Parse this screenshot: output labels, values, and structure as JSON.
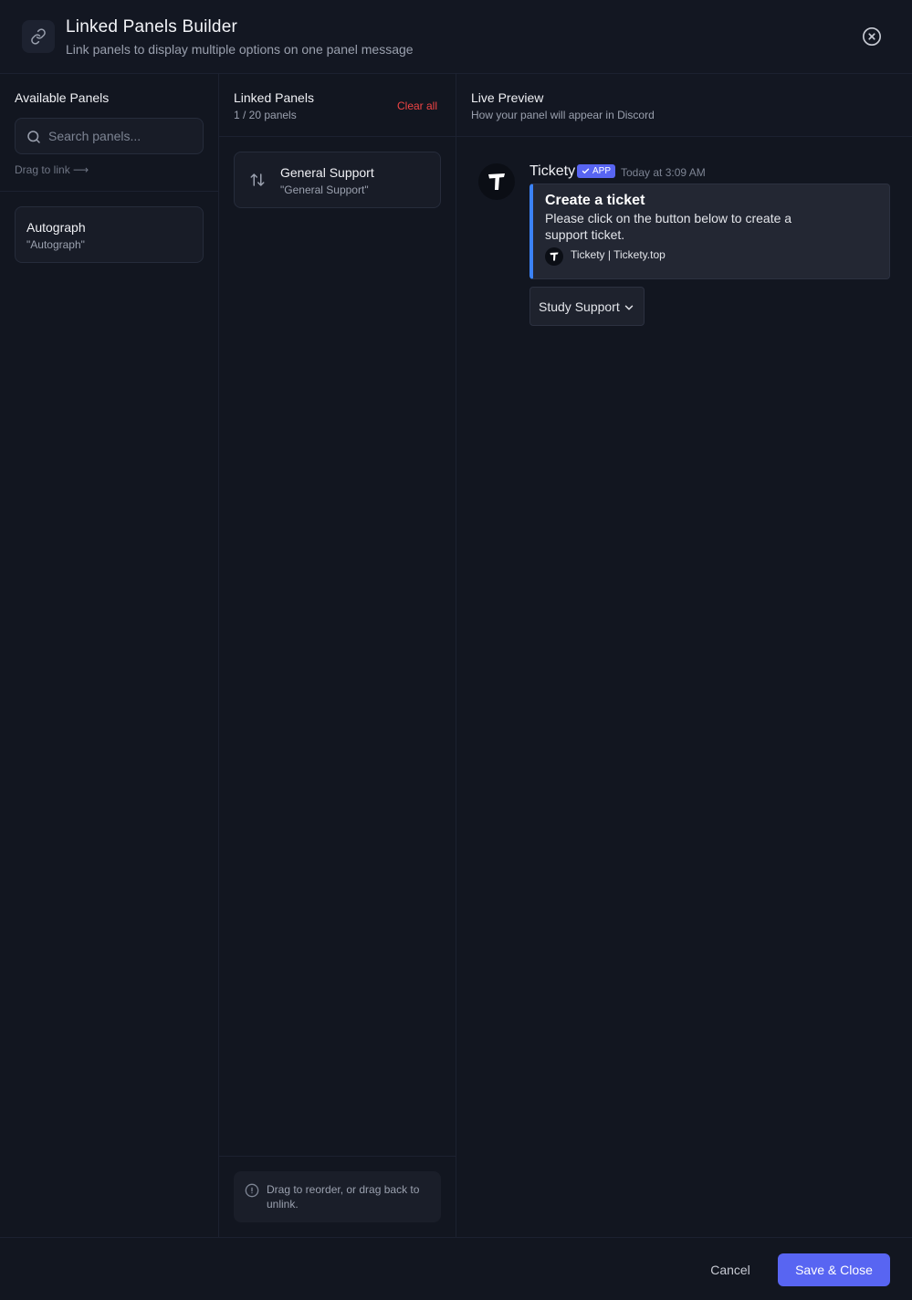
{
  "header": {
    "title": "Linked Panels Builder",
    "subtitle": "Link panels to display multiple options on one panel message"
  },
  "available": {
    "title": "Available Panels",
    "search_placeholder": "Search panels...",
    "drag_hint": "Drag to link ⟶",
    "panels": [
      {
        "name": "Autograph",
        "quote": "\"Autograph\""
      }
    ]
  },
  "linked": {
    "title": "Linked Panels",
    "count": "1 / 20 panels",
    "clear_label": "Clear all",
    "panels": [
      {
        "name": "General Support",
        "quote": "\"General Support\""
      }
    ],
    "footer_hint": "Drag to reorder, or drag back to unlink."
  },
  "preview": {
    "title": "Live Preview",
    "subtitle": "How your panel will appear in Discord",
    "bot_name": "Tickety",
    "badge": "APP",
    "timestamp": "Today at 3:09 AM",
    "embed": {
      "title": "Create a ticket",
      "description": "Please click on the button below to create a support ticket.",
      "footer": "Tickety | Tickety.top",
      "accent_color": "#3b82f6"
    },
    "select_label": "Study Support"
  },
  "footer": {
    "cancel_label": "Cancel",
    "save_label": "Save & Close"
  },
  "colors": {
    "background": "#121620",
    "primary": "#5865f2",
    "danger": "#ef4444"
  }
}
